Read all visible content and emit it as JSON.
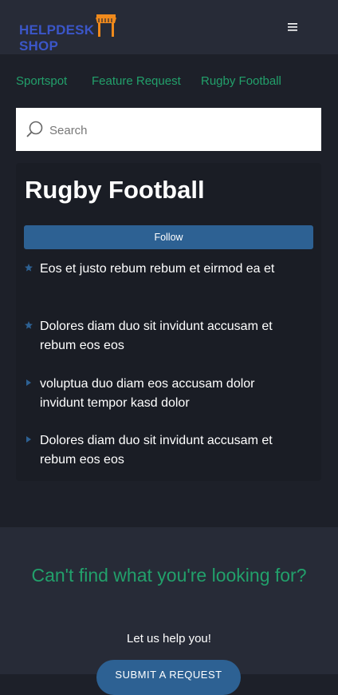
{
  "header": {
    "logo_text": "HELPDESK SHOP",
    "menu_icon": "hamburger-menu-icon"
  },
  "breadcrumb": [
    "Sportspot",
    "Feature Request",
    "Rugby Football"
  ],
  "search": {
    "placeholder": "Search"
  },
  "topic": {
    "title": "Rugby Football",
    "follow_label": "Follow",
    "items": [
      {
        "icon": "star-icon",
        "text": "Eos et justo rebum rebum et eirmod ea et"
      },
      {
        "icon": "star-icon",
        "text": "Dolores diam duo sit invidunt accusam et rebum eos eos"
      },
      {
        "icon": "triangle-right-icon",
        "text": "voluptua duo diam eos accusam dolor invidunt tempor kasd dolor"
      },
      {
        "icon": "triangle-right-icon",
        "text": "Dolores diam duo sit invidunt accusam et rebum eos eos"
      }
    ]
  },
  "footer": {
    "heading": "Can't find what you're looking for?",
    "subtext": "Let us help you!",
    "button_label": "SUBMIT A REQUEST"
  },
  "colors": {
    "background": "#1d2029",
    "header": "#272b37",
    "accent_green": "#22a06b",
    "button_blue": "#2d6193",
    "logo_blue": "#3b56c8",
    "logo_orange": "#f08a1c"
  }
}
